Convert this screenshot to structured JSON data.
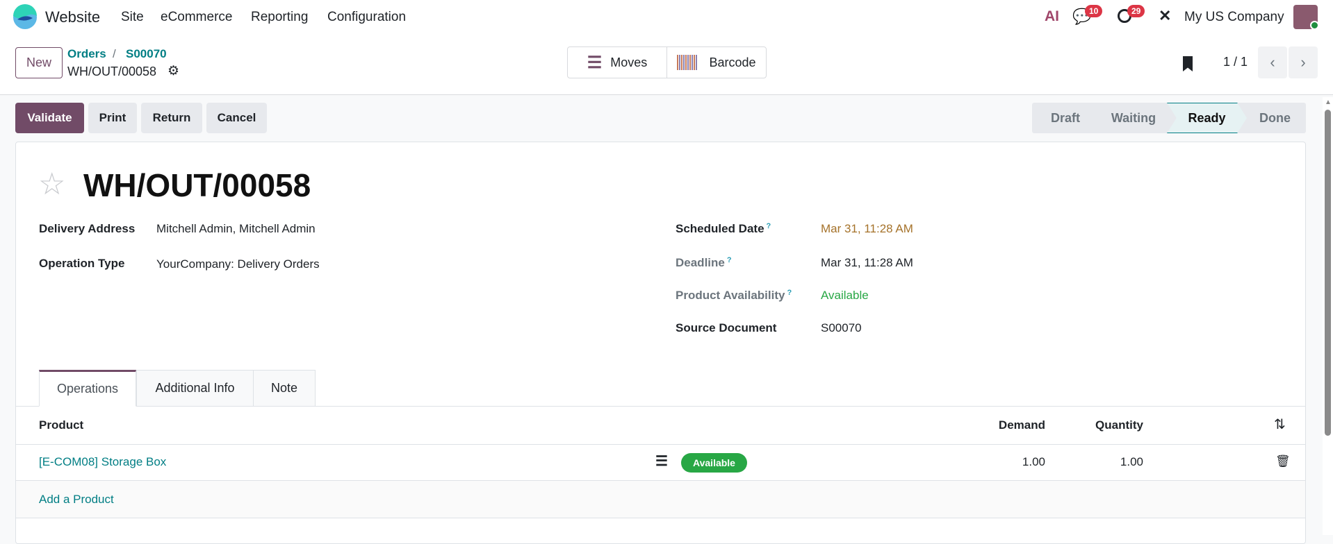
{
  "nav": {
    "app": "Website",
    "menu": [
      "Site",
      "eCommerce",
      "Reporting",
      "Configuration"
    ],
    "ai_label": "AI",
    "messages_count": "10",
    "activities_count": "29",
    "company": "My US Company"
  },
  "control": {
    "new_label": "New",
    "breadcrumb_parent": "Orders",
    "breadcrumb_sep": "/",
    "breadcrumb_order": "S00070",
    "record": "WH/OUT/00058",
    "moves_label": "Moves",
    "barcode_label": "Barcode",
    "pager": "1 / 1"
  },
  "actions": {
    "validate": "Validate",
    "print": "Print",
    "return": "Return",
    "cancel": "Cancel"
  },
  "status": {
    "steps": [
      "Draft",
      "Waiting",
      "Ready",
      "Done"
    ],
    "active": "Ready"
  },
  "form": {
    "title": "WH/OUT/00058",
    "left": [
      {
        "label": "Delivery Address",
        "value": "Mitchell Admin, Mitchell Admin"
      },
      {
        "label": "Operation Type",
        "value": "YourCompany: Delivery Orders"
      }
    ],
    "right": [
      {
        "label": "Scheduled Date",
        "help": "?",
        "value": "Mar 31, 11:28 AM"
      },
      {
        "label": "Deadline",
        "help": "?",
        "value": "Mar 31, 11:28 AM"
      },
      {
        "label": "Product Availability",
        "help": "?",
        "value": "Available"
      },
      {
        "label": "Source Document",
        "value": "S00070"
      }
    ]
  },
  "tabs": [
    "Operations",
    "Additional Info",
    "Note"
  ],
  "table": {
    "headers": {
      "product": "Product",
      "demand": "Demand",
      "quantity": "Quantity"
    },
    "rows": [
      {
        "product": "[E-COM08] Storage Box",
        "badge": "Available",
        "demand": "1.00",
        "quantity": "1.00"
      }
    ],
    "add": "Add a Product"
  },
  "colors": {
    "primary": "#714b67",
    "link": "#017e84",
    "success": "#28a745",
    "warning": "#a5722a"
  }
}
